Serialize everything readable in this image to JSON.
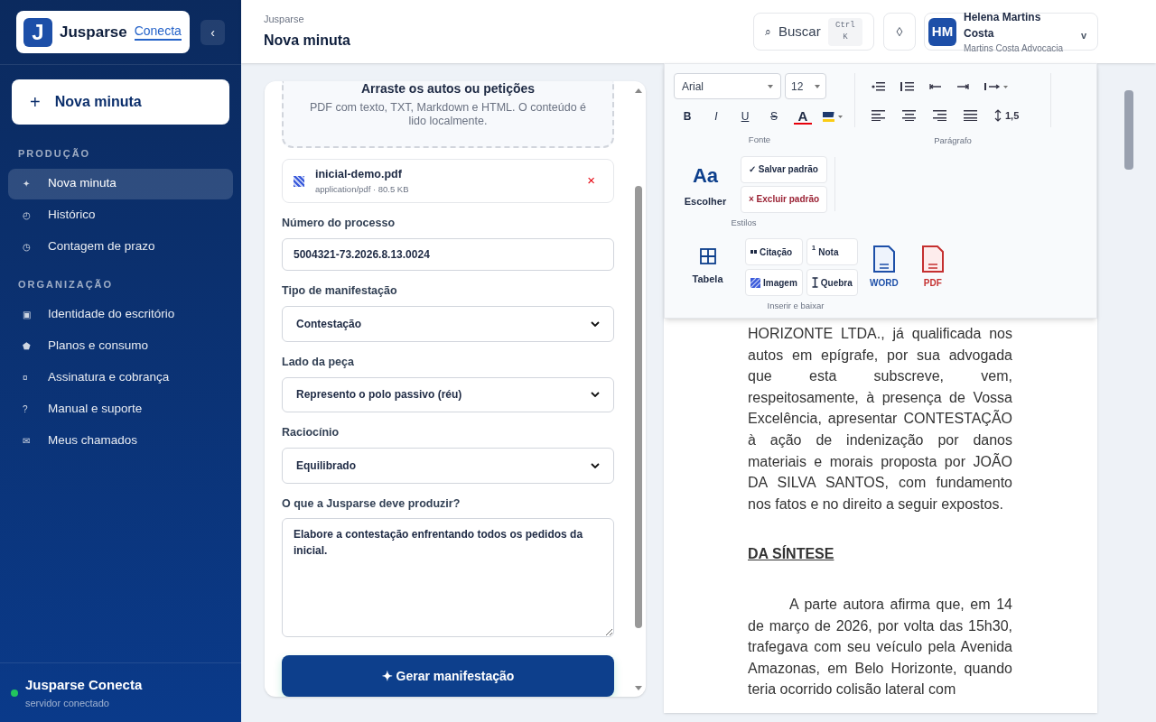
{
  "sidebar": {
    "logo_letter": "J",
    "brand": "Jusparse",
    "brand_suffix": "Conecta",
    "collapse": "‹",
    "new_button": {
      "icon": "+",
      "label": "Nova minuta"
    },
    "sections": [
      {
        "title": "PRODUÇÃO",
        "items": [
          {
            "icon": "✦",
            "label": "Nova minuta",
            "selected": true
          },
          {
            "icon": "◴",
            "label": "Histórico",
            "selected": false
          },
          {
            "icon": "◷",
            "label": "Contagem de prazo",
            "selected": false
          }
        ]
      },
      {
        "title": "ORGANIZAÇÃO",
        "items": [
          {
            "icon": "▣",
            "label": "Identidade do escritório",
            "selected": false
          },
          {
            "icon": "⬟",
            "label": "Planos e consumo",
            "selected": false
          },
          {
            "icon": "¤",
            "label": "Assinatura e cobrança",
            "selected": false
          },
          {
            "icon": "?",
            "label": "Manual e suporte",
            "selected": false
          },
          {
            "icon": "✉",
            "label": "Meus chamados",
            "selected": false
          }
        ]
      }
    ],
    "status": {
      "title": "Jusparse Conecta",
      "subtitle": "servidor conectado",
      "color": "#22c55e"
    }
  },
  "header": {
    "breadcrumb": "Jusparse",
    "title": "Nova minuta",
    "search": {
      "icon": "⌕",
      "label": "Buscar",
      "shortcut": "Ctrl K"
    },
    "theme_icon": "◊",
    "user": {
      "initials": "HM",
      "name": "Helena Martins Costa",
      "org": "Martins Costa Advocacia",
      "caret": "v"
    }
  },
  "form": {
    "dropzone": {
      "title": "Arraste os autos ou petições",
      "hint": "PDF com texto, TXT, Markdown e HTML. O conteúdo é lido localmente."
    },
    "file": {
      "name": "inicial-demo.pdf",
      "meta": "application/pdf · 80.5 KB",
      "remove": "×"
    },
    "fields": [
      {
        "kind": "input",
        "label": "Número do processo",
        "value": "5004321-73.2026.8.13.0024"
      },
      {
        "kind": "select",
        "label": "Tipo de manifestação",
        "value": "Contestação"
      },
      {
        "kind": "select",
        "label": "Lado da peça",
        "value": "Represento o polo passivo (réu)"
      },
      {
        "kind": "select",
        "label": "Raciocínio",
        "value": "Equilibrado"
      },
      {
        "kind": "textarea",
        "label": "O que a Jusparse deve produzir?",
        "value": "Elabore a contestação enfrentando todos os pedidos da inicial."
      }
    ],
    "submit": "✦ Gerar manifestação"
  },
  "toolbar": {
    "font": "Arial",
    "size": "12",
    "format_buttons": [
      {
        "kind": "bold",
        "label": "B"
      },
      {
        "kind": "italic",
        "label": "I"
      },
      {
        "kind": "underline",
        "label": "U"
      },
      {
        "kind": "strike",
        "label": "S"
      },
      {
        "kind": "color",
        "label": "A"
      }
    ],
    "line_spacing": "1,5",
    "groups": [
      "Fonte",
      "Parágrafo",
      "Estilos",
      "Inserir e baixar"
    ],
    "styles": {
      "icon": "Aa",
      "label": "Escolher",
      "save": "✓ Salvar padrão",
      "delete": "× Excluir padrão"
    },
    "insert": {
      "table": "Tabela",
      "buttons": [
        {
          "kind": "quote",
          "label": "Citação"
        },
        {
          "kind": "note",
          "label": "Nota",
          "mark": "1"
        },
        {
          "kind": "image",
          "label": "Imagem"
        },
        {
          "kind": "break",
          "label": "Quebra"
        }
      ]
    },
    "exports": [
      {
        "kind": "word",
        "label": "WORD"
      },
      {
        "kind": "pdf",
        "label": "PDF"
      }
    ]
  },
  "document": [
    {
      "kind": "paragraph",
      "text": "HORIZONTE LTDA., já qualificada nos autos em epígrafe, por sua advogada que esta subscreve, vem, respeitosamente, à presença de Vossa Excelência, apresentar CONTESTAÇÃO à ação de indenização por danos materiais e morais proposta por JOÃO DA SILVA SANTOS, com fundamento nos fatos e no direito a seguir expostos."
    },
    {
      "kind": "heading",
      "text": "DA SÍNTESE"
    },
    {
      "kind": "indented",
      "text": "A parte autora afirma que, em 14 de março de 2026, por volta das 15h30, trafegava com seu veículo pela Avenida Amazonas, em Belo Horizonte, quando teria ocorrido colisão lateral com"
    }
  ]
}
